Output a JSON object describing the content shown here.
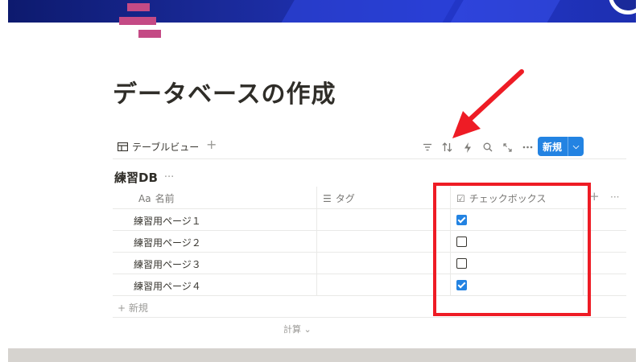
{
  "page": {
    "title": "データベースの作成"
  },
  "view": {
    "tab_label": "テーブルビュー",
    "add_symbol": "+",
    "new_button_label": "新規",
    "toolbar_icons": [
      "filter-icon",
      "sort-icon",
      "automation-icon",
      "search-icon",
      "expand-icon",
      "more-icon"
    ]
  },
  "database": {
    "title": "練習DB",
    "more": "···",
    "columns": [
      {
        "label": "名前",
        "type_glyph": "Aa"
      },
      {
        "label": "タグ",
        "type_glyph": "☰"
      },
      {
        "label": "チェックボックス",
        "type_glyph": "☑"
      }
    ],
    "rows": [
      {
        "name": "練習用ページ１",
        "checked": true
      },
      {
        "name": "練習用ページ２",
        "checked": false
      },
      {
        "name": "練習用ページ３",
        "checked": false
      },
      {
        "name": "練習用ページ４",
        "checked": true
      }
    ],
    "add_row_label": "+ 新規",
    "calc_label": "計算 ⌄",
    "header_add": "+",
    "header_more": "···"
  },
  "colors": {
    "accent": "#2383e2",
    "annotation": "#ee1c25",
    "page_icon": "#c44a85"
  }
}
